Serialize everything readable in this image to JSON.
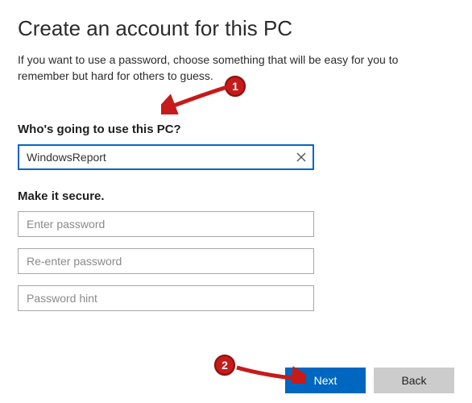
{
  "header": {
    "title": "Create an account for this PC",
    "description": "If you want to use a password, choose something that will be easy for you to remember but hard for others to guess."
  },
  "username": {
    "label": "Who's going to use this PC?",
    "value": "WindowsReport"
  },
  "secure": {
    "label": "Make it secure.",
    "password_placeholder": "Enter password",
    "confirm_placeholder": "Re-enter password",
    "hint_placeholder": "Password hint"
  },
  "footer": {
    "next_label": "Next",
    "back_label": "Back"
  },
  "annotations": {
    "badge1": "1",
    "badge2": "2"
  }
}
